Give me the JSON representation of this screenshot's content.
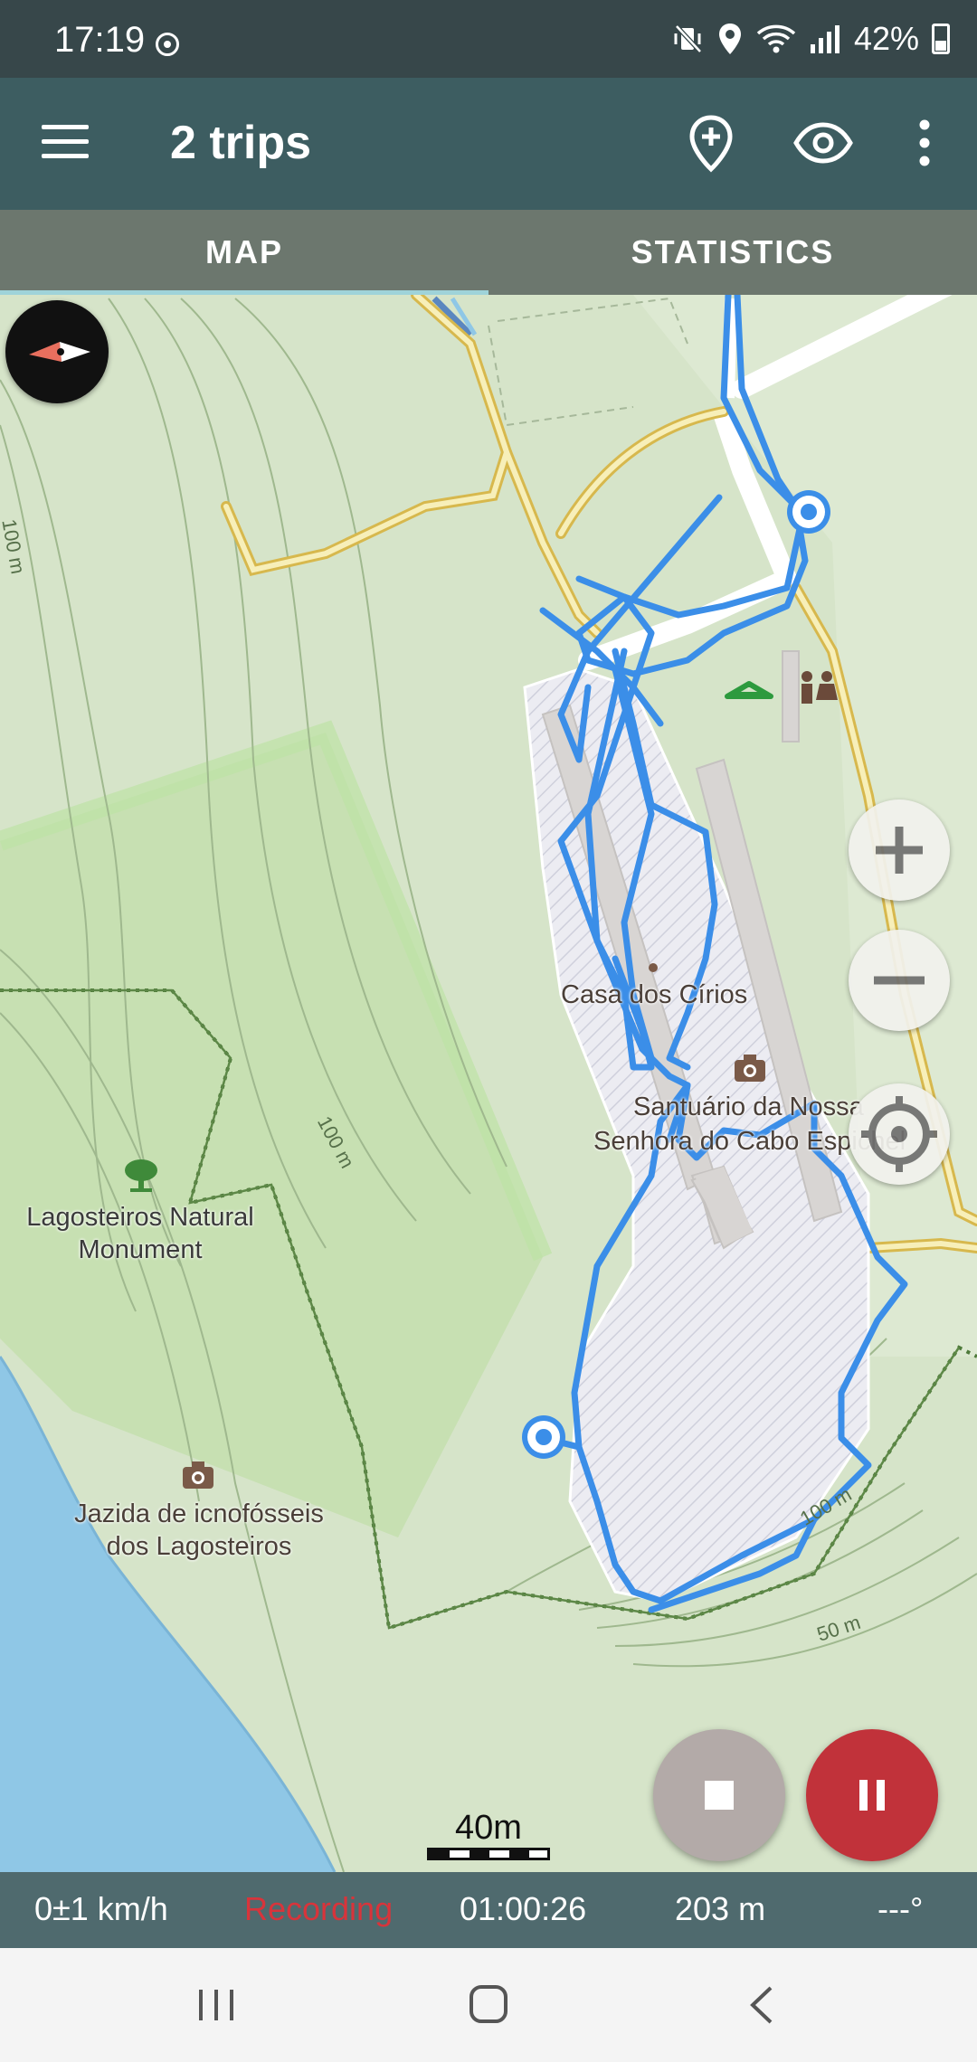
{
  "status_bar": {
    "time": "17:19",
    "battery": "42%",
    "icons": [
      "recording-dot-icon",
      "vibrate-off-icon",
      "location-icon",
      "wifi-icon",
      "signal-icon",
      "battery-icon"
    ]
  },
  "app_bar": {
    "title": "2 trips",
    "actions": [
      "add-marker-icon",
      "eye-icon",
      "more-icon"
    ]
  },
  "tabs": [
    {
      "label": "MAP",
      "active": true
    },
    {
      "label": "STATISTICS",
      "active": false
    }
  ],
  "map": {
    "labels": {
      "casa": "Casa dos Círios",
      "santuario_1": "Santuário da Nossa",
      "santuario_2": "Senhora do Cabo Espichel",
      "lagosteiros_1": "Lagosteiros Natural",
      "lagosteiros_2": "Monument",
      "jazida_1": "Jazida de icnofósseis",
      "jazida_2": "dos Lagosteiros",
      "contour_100_a": "100 m",
      "contour_100_b": "100 m",
      "contour_100_c": "100 m",
      "contour_50": "50 m"
    },
    "scale": "40m"
  },
  "info_bar": {
    "speed": "0±1 km/h",
    "status": "Recording",
    "duration": "01:00:26",
    "elevation": "203 m",
    "heading": "---°"
  },
  "colors": {
    "status_bar": "#37474a",
    "app_bar": "#3d5d61",
    "track": "#3b8ee8",
    "recording": "#d8343b",
    "pause_button": "#c1323a",
    "stop_button": "#b3aaa8"
  }
}
